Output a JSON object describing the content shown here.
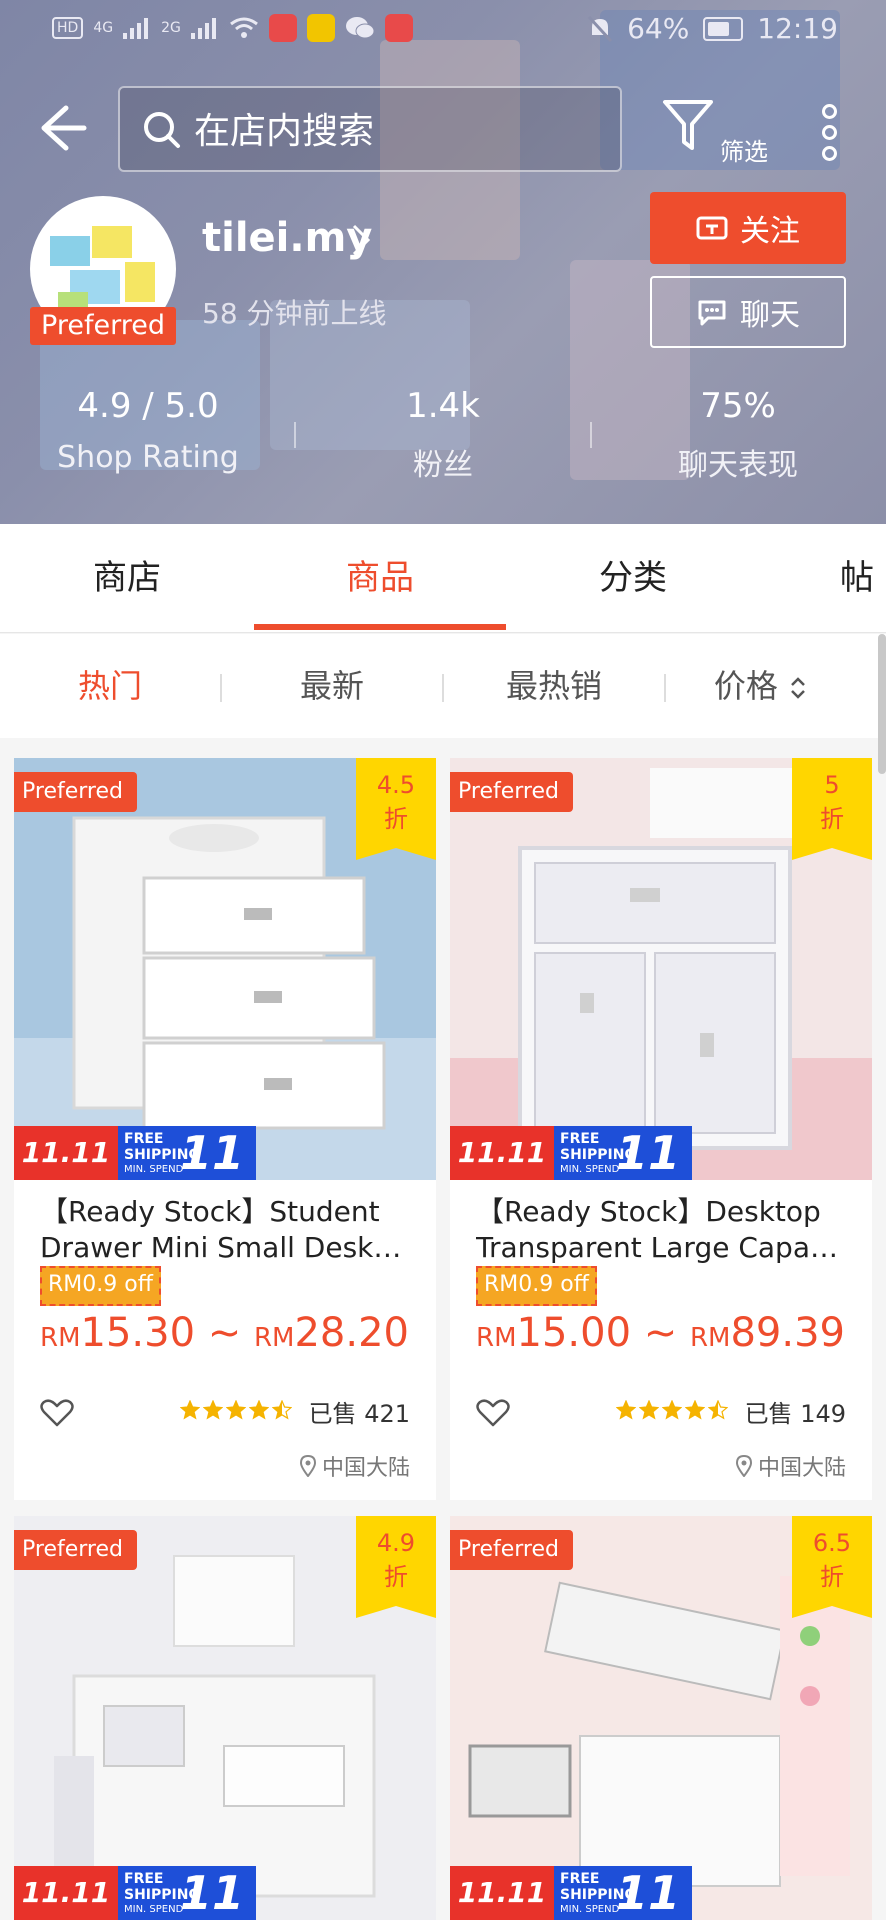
{
  "status_bar": {
    "left_chips": [
      "HD",
      "4G",
      "2G"
    ],
    "battery": "64%",
    "time": "12:19"
  },
  "search": {
    "placeholder": "在店内搜索"
  },
  "filter_label": "筛选",
  "shop": {
    "name": "tilei.my",
    "preferred_label": "Preferred",
    "online_status": "58 分钟前上线",
    "follow_label": "关注",
    "chat_label": "聊天"
  },
  "stats": [
    {
      "value": "4.9 / 5.0",
      "label": "Shop Rating"
    },
    {
      "value": "1.4k",
      "label": "粉丝"
    },
    {
      "value": "75%",
      "label": "聊天表现"
    }
  ],
  "tabs": [
    "商店",
    "商品",
    "分类",
    "帖"
  ],
  "active_tab": "商品",
  "sort": [
    "热门",
    "最新",
    "最热销",
    "价格"
  ],
  "products": [
    {
      "badge": "Preferred",
      "discount": "4.5",
      "discount_unit": "折",
      "promo_11": "11.11",
      "free_shipping": "FREE",
      "shipping": "SHIPPING",
      "min_spend": "MIN. SPEND",
      "min_amount": "11",
      "title_line1": "【Ready Stock】Student",
      "title_line2": "Drawer Mini Small Deskt...",
      "voucher": "RM0.9 off",
      "price_low": "15.30",
      "price_high": "28.20",
      "currency": "RM",
      "tilde": "~",
      "rating": 4.5,
      "sold": "已售 421",
      "location": "中国大陆"
    },
    {
      "badge": "Preferred",
      "discount": "5",
      "discount_unit": "折",
      "promo_11": "11.11",
      "free_shipping": "FREE",
      "shipping": "SHIPPING",
      "min_spend": "MIN. SPEND",
      "min_amount": "11",
      "title_line1": "【Ready Stock】Desktop",
      "title_line2": "Transparent Large Capac...",
      "voucher": "RM0.9 off",
      "price_low": "15.00",
      "price_high": "89.39",
      "currency": "RM",
      "tilde": "~",
      "rating": 4.5,
      "sold": "已售 149",
      "location": "中国大陆"
    },
    {
      "badge": "Preferred",
      "discount": "4.9",
      "discount_unit": "折",
      "promo_11": "11.11",
      "free_shipping": "FREE",
      "shipping": "SHIPPING",
      "min_spend": "MIN. SPEND",
      "min_amount": "11",
      "title_line1": "",
      "title_line2": "",
      "voucher": "",
      "price_low": "",
      "price_high": "",
      "currency": "",
      "tilde": "",
      "rating": 0,
      "sold": "",
      "location": ""
    },
    {
      "badge": "Preferred",
      "discount": "6.5",
      "discount_unit": "折",
      "promo_11": "11.11",
      "free_shipping": "FREE",
      "shipping": "SHIPPING",
      "min_spend": "MIN. SPEND",
      "min_amount": "11",
      "title_line1": "",
      "title_line2": "",
      "voucher": "",
      "price_low": "",
      "price_high": "",
      "currency": "",
      "tilde": "",
      "rating": 0,
      "sold": "",
      "location": ""
    }
  ],
  "colors": {
    "accent": "#ee4d2d",
    "discount_yellow": "#ffd600",
    "star": "#f5b301"
  }
}
